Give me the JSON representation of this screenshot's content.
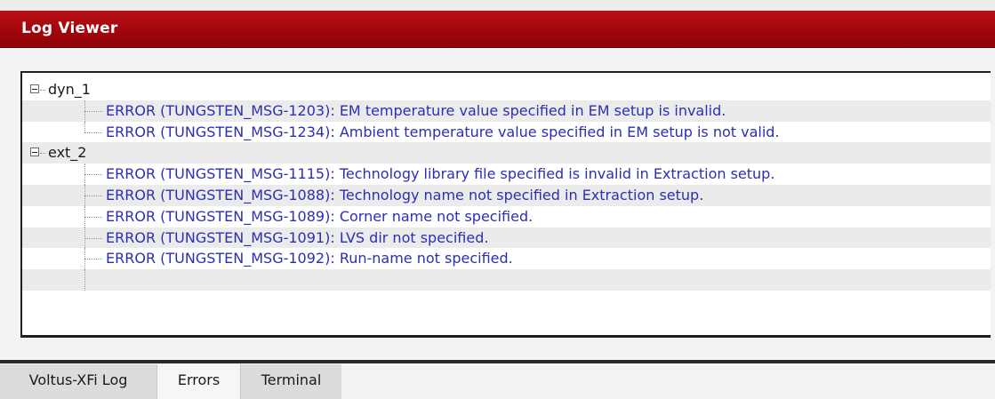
{
  "window": {
    "title": "Log Viewer"
  },
  "colors": {
    "titlebar": "#a1060c",
    "error_text": "#2b2fb5",
    "stripe": "#ebebeb"
  },
  "tree": {
    "groups": [
      {
        "label": "dyn_1",
        "expanded": true,
        "items": [
          "ERROR (TUNGSTEN_MSG-1203): EM temperature value specified in EM setup is invalid.",
          "ERROR (TUNGSTEN_MSG-1234): Ambient temperature value specified in EM setup is not valid."
        ]
      },
      {
        "label": "ext_2",
        "expanded": true,
        "items": [
          "ERROR (TUNGSTEN_MSG-1115): Technology library file specified is invalid in Extraction setup.",
          "ERROR (TUNGSTEN_MSG-1088): Technology name not specified in Extraction setup.",
          "ERROR (TUNGSTEN_MSG-1089): Corner name not specified.",
          "ERROR (TUNGSTEN_MSG-1091): LVS dir not specified.",
          "ERROR (TUNGSTEN_MSG-1092): Run-name not specified."
        ]
      }
    ]
  },
  "tabs": {
    "active": "Errors",
    "items": [
      "Voltus-XFi Log",
      "Errors",
      "Terminal"
    ]
  }
}
